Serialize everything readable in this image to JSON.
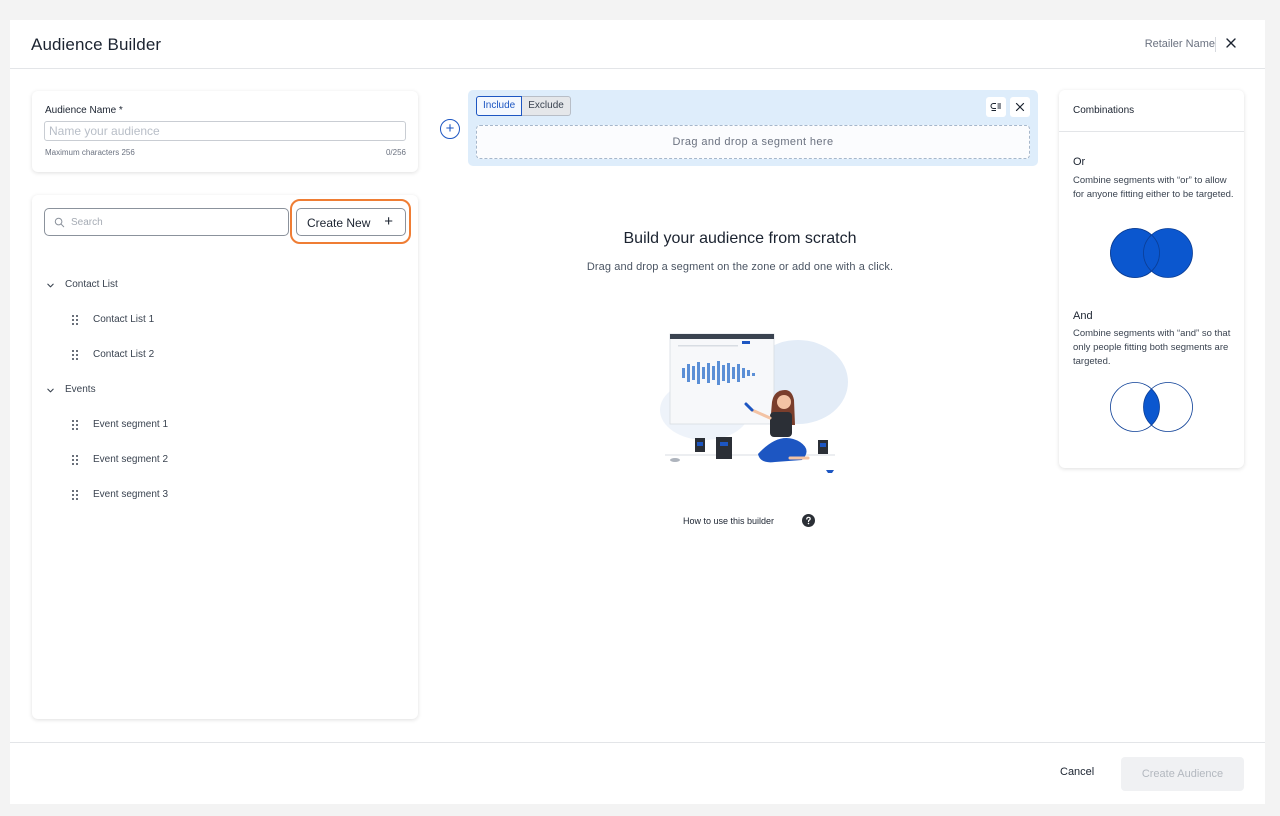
{
  "header": {
    "title": "Audience Builder",
    "retailer": "Retailer Name",
    "close_icon": "close-icon"
  },
  "audience_name": {
    "label": "Audience Name *",
    "value": "",
    "placeholder": "Name your audience",
    "hint": "Maximum characters 256",
    "count": "0/256"
  },
  "segments": {
    "search_placeholder": "Search",
    "create_new_label": "Create New",
    "create_new_icon": "plus-icon",
    "highlight_color": "#ef7d34",
    "groups": [
      {
        "label": "Contact List",
        "expanded": true,
        "items": [
          "Contact List 1",
          "Contact List 2"
        ]
      },
      {
        "label": "Events",
        "expanded": true,
        "items": [
          "Event segment 1",
          "Event segment 2",
          "Event segment 3"
        ]
      }
    ]
  },
  "builder": {
    "tabs": [
      {
        "label": "Include",
        "active": true
      },
      {
        "label": "Exclude",
        "active": false
      }
    ],
    "drop_placeholder": "Drag and drop a segment here",
    "add_icon": "plus-circle-icon",
    "empty_title": "Build your audience from scratch",
    "empty_subtitle": "Drag and drop a segment on the zone or add one with a click.",
    "help_label": "How to use this builder",
    "help_icon": "question-circle-icon"
  },
  "combinations": {
    "title": "Combinations",
    "or": {
      "title": "Or",
      "description": "Combine segments with “or” to allow for anyone fitting either to be targeted."
    },
    "and": {
      "title": "And",
      "description": "Combine segments with “and” so that only people fitting both segments are targeted."
    },
    "accent_color": "#1d56c2"
  },
  "footer": {
    "cancel_label": "Cancel",
    "create_label": "Create Audience"
  }
}
